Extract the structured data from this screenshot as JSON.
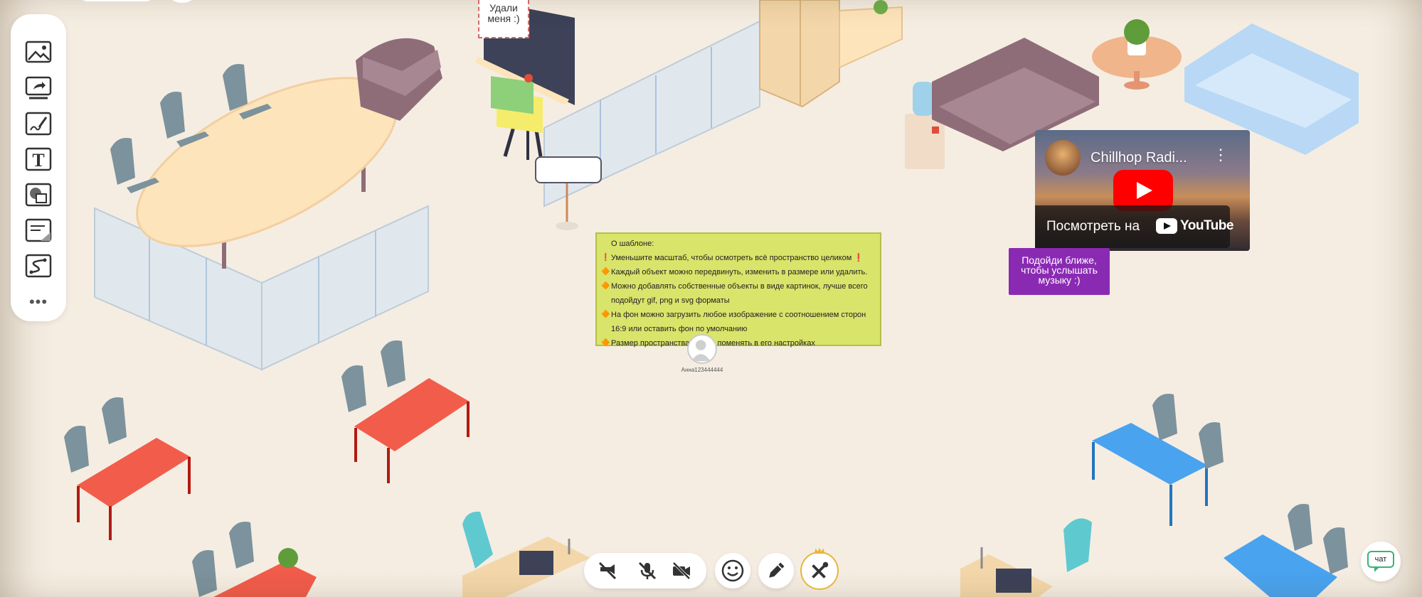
{
  "toolbar": {
    "tools": [
      {
        "icon": "image-icon"
      },
      {
        "icon": "screen-share-icon"
      },
      {
        "icon": "draw-icon"
      },
      {
        "icon": "text-icon",
        "glyph": "T"
      },
      {
        "icon": "shapes-icon"
      },
      {
        "icon": "sticky-note-icon"
      },
      {
        "icon": "connector-icon"
      }
    ],
    "more": "•••"
  },
  "sticky": {
    "line1": "Удали",
    "line2": "меня :)"
  },
  "info_note": {
    "lines": [
      {
        "marker": "",
        "text": "О шаблоне:"
      },
      {
        "marker": "❗",
        "text": "Уменьшите масштаб, чтобы осмотреть всё пространство целиком ❗"
      },
      {
        "marker": "🔶",
        "text": "Каждый объект можно передвинуть, изменить в размере или удалить."
      },
      {
        "marker": "🔶",
        "text": "Можно добавлять собственные объекты в виде картинок, лучше всего"
      },
      {
        "marker": "",
        "text": "подойдут gif, png и svg форматы"
      },
      {
        "marker": "🔶",
        "text": "На фон можно загрузить любое изображение с соотношением сторон"
      },
      {
        "marker": "",
        "text": "16:9 или оставить фон по умолчанию"
      },
      {
        "marker": "🔶",
        "text": "Размер пространства можно поменять в его настройках"
      }
    ]
  },
  "avatar": {
    "name": "Анна123444444"
  },
  "youtube": {
    "title": "Chillhop Radi...",
    "watch_on": "Посмотреть на",
    "logo_text": "YouTube"
  },
  "music_note": {
    "line1": "Подойди ближе,",
    "line2": "чтобы услышать",
    "line3": "музыку :)"
  },
  "controls": {
    "screen_share_off_icon": "screen-share-off-icon",
    "mic_off_icon": "mic-off-icon",
    "camera_off_icon": "camera-off-icon",
    "emoji_icon": "smile-icon",
    "pen_icon": "pencil-icon",
    "tools_icon": "tools-icon"
  },
  "chat": {
    "label": "чат"
  },
  "colors": {
    "background": "#f5ede2",
    "note_yellow": "#d9e46a",
    "purple": "#8a2ab3",
    "table_red": "#f25c4b",
    "table_blue": "#4aa3ee",
    "chair_gray": "#7c929c",
    "sofa_mauve": "#8e6d79",
    "sofa_blue": "#b8d8f5",
    "admin_gold": "#e8b73a"
  }
}
